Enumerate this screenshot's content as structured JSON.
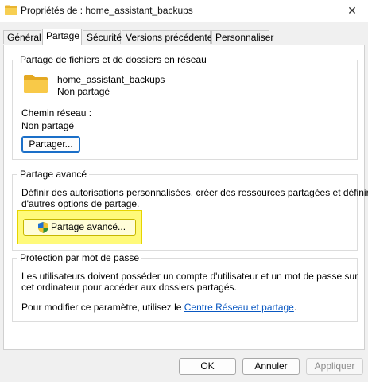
{
  "window": {
    "title": "Propriétés de : home_assistant_backups",
    "close_glyph": "✕"
  },
  "tabs": [
    {
      "label": "Général"
    },
    {
      "label": "Partage"
    },
    {
      "label": "Sécurité"
    },
    {
      "label": "Versions précédentes"
    },
    {
      "label": "Personnaliser"
    }
  ],
  "network_sharing": {
    "title": "Partage de fichiers et de dossiers en réseau",
    "folder_name": "home_assistant_backups",
    "folder_status": "Non partagé",
    "path_label": "Chemin réseau :",
    "path_value": "Non partagé",
    "share_button": "Partager..."
  },
  "advanced_sharing": {
    "title": "Partage avancé",
    "description_line1": "Définir des autorisations personnalisées, créer des ressources partagées et définir",
    "description_line2": "d'autres options de partage.",
    "button": "Partage avancé..."
  },
  "password_protection": {
    "title": "Protection par mot de passe",
    "line1": "Les utilisateurs doivent posséder un compte d'utilisateur et un mot de passe sur",
    "line2": "cet ordinateur pour accéder aux dossiers partagés.",
    "modify_prefix": "Pour modifier ce paramètre, utilisez le ",
    "modify_link": "Centre Réseau et partage",
    "modify_suffix": "."
  },
  "footer": {
    "ok": "OK",
    "cancel": "Annuler",
    "apply": "Appliquer"
  },
  "colors": {
    "highlight": "#fffa7a",
    "link": "#0a58c2",
    "folder": "#f4c542"
  }
}
